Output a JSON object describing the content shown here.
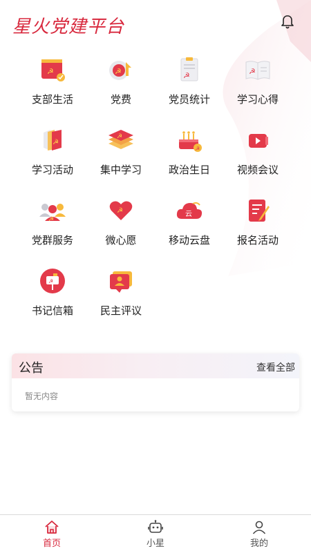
{
  "header": {
    "title": "星火党建平台",
    "bell_icon": "bell-icon"
  },
  "colors": {
    "brand": "#d8283d",
    "accent_yellow": "#f7b93c",
    "text": "#222222"
  },
  "grid": {
    "items": [
      {
        "label": "支部生活",
        "icon": "branch-life-icon"
      },
      {
        "label": "党费",
        "icon": "party-fee-icon"
      },
      {
        "label": "党员统计",
        "icon": "member-statistics-icon"
      },
      {
        "label": "学习心得",
        "icon": "study-notes-icon"
      },
      {
        "label": "学习活动",
        "icon": "study-activity-icon"
      },
      {
        "label": "集中学习",
        "icon": "group-study-icon"
      },
      {
        "label": "政治生日",
        "icon": "political-birthday-icon"
      },
      {
        "label": "视频会议",
        "icon": "video-meeting-icon"
      },
      {
        "label": "党群服务",
        "icon": "party-mass-service-icon"
      },
      {
        "label": "微心愿",
        "icon": "micro-wish-icon"
      },
      {
        "label": "移动云盘",
        "icon": "cloud-drive-icon"
      },
      {
        "label": "报名活动",
        "icon": "signup-activity-icon"
      },
      {
        "label": "书记信箱",
        "icon": "secretary-mailbox-icon"
      },
      {
        "label": "民主评议",
        "icon": "democratic-review-icon"
      }
    ]
  },
  "notice": {
    "title": "公告",
    "more_label": "查看全部",
    "empty_text": "暂无内容"
  },
  "tabbar": {
    "tabs": [
      {
        "label": "首页",
        "icon": "home-icon",
        "active": true
      },
      {
        "label": "小星",
        "icon": "robot-icon",
        "active": false
      },
      {
        "label": "我的",
        "icon": "user-icon",
        "active": false
      }
    ]
  }
}
